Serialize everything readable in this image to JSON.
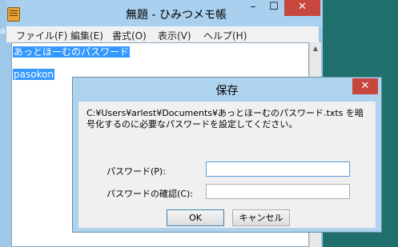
{
  "notepad": {
    "title": "無題 - ひみつメモ帳",
    "controls": {
      "minimize": "–",
      "maximize": "☐",
      "close": "✕"
    },
    "menu": [
      "ファイル(F)",
      "編集(E)",
      "書式(O)",
      "表示(V)",
      "ヘルプ(H)"
    ],
    "lines": [
      "あっとほーむのパスワード",
      "pasokon"
    ],
    "scroll_up": "▲",
    "left_char": "a"
  },
  "dialog": {
    "title": "保存",
    "close": "✕",
    "message": "C:¥Users¥arlest¥Documents¥あっとほーむのパスワード.txts を暗号化するのに必要なパスワードを設定してください。",
    "password_label": "パスワード(P):",
    "confirm_label": "パスワードの確認(C):",
    "password_value": "",
    "confirm_value": "",
    "ok_label": "OK",
    "cancel_label": "キャンセル"
  }
}
